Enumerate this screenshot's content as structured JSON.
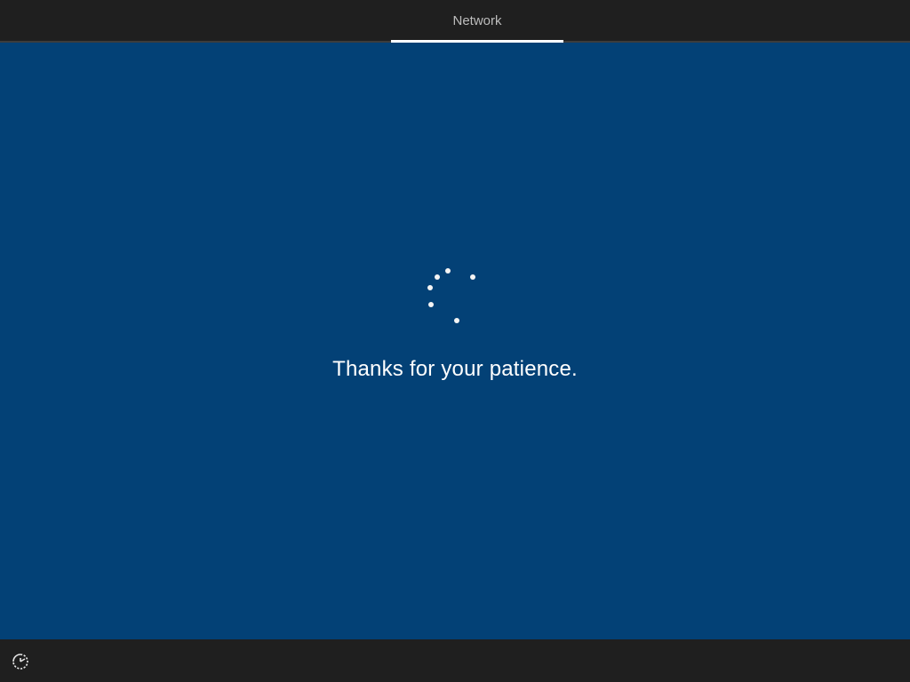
{
  "header": {
    "active_tab": "Network"
  },
  "main": {
    "message": "Thanks for your patience.",
    "spinner_icon": "loading-spinner-icon"
  },
  "footer": {
    "accessibility_icon": "ease-of-access-icon"
  },
  "colors": {
    "background_blue": "#034176",
    "bar_dark": "#1f1f1f",
    "text_white": "#ffffff",
    "tab_text": "#bdbdbd"
  }
}
